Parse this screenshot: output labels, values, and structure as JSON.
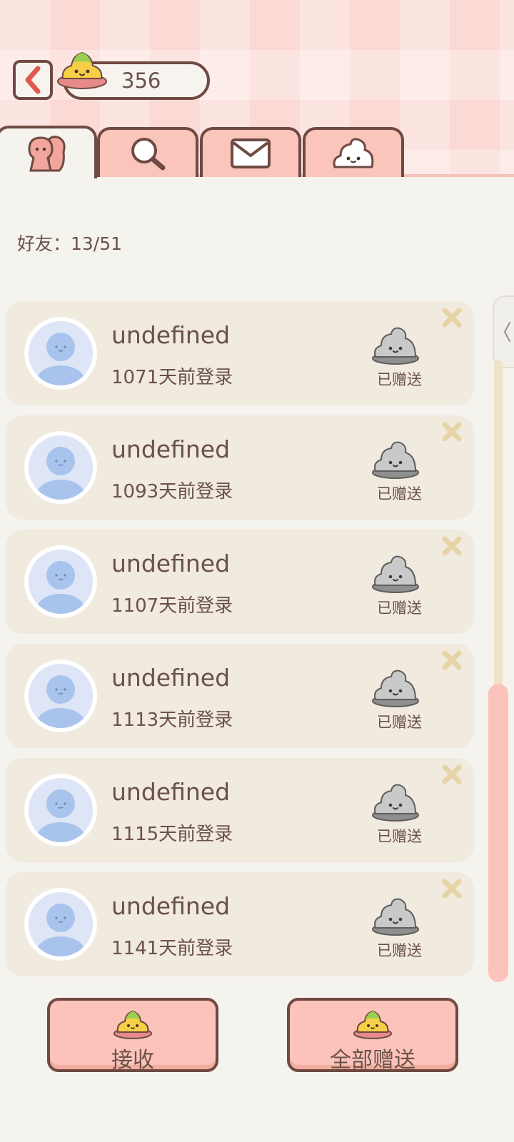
{
  "header": {
    "coin_count": "356"
  },
  "tabs": [
    {
      "icon": "friends-icon",
      "active": true
    },
    {
      "icon": "search-icon",
      "active": false
    },
    {
      "icon": "mail-icon",
      "active": false
    },
    {
      "icon": "mascot-icon",
      "active": false
    }
  ],
  "friends": {
    "count_label": "好友：13/51"
  },
  "friend_list": [
    {
      "name": "undefined",
      "last_login": "1071天前登录",
      "gift_status": "已赠送"
    },
    {
      "name": "undefined",
      "last_login": "1093天前登录",
      "gift_status": "已赠送"
    },
    {
      "name": "undefined",
      "last_login": "1107天前登录",
      "gift_status": "已赠送"
    },
    {
      "name": "undefined",
      "last_login": "1113天前登录",
      "gift_status": "已赠送"
    },
    {
      "name": "undefined",
      "last_login": "1115天前登录",
      "gift_status": "已赠送"
    },
    {
      "name": "undefined",
      "last_login": "1141天前登录",
      "gift_status": "已赠送"
    }
  ],
  "actions": {
    "receive_label": "接收",
    "gift_all_label": "全部赠送"
  },
  "colors": {
    "accent_pink": "#fbc3ba",
    "outline_brown": "#6e4a42",
    "card_bg": "#f0eadf",
    "avatar_blue": "#a8c3ec"
  }
}
